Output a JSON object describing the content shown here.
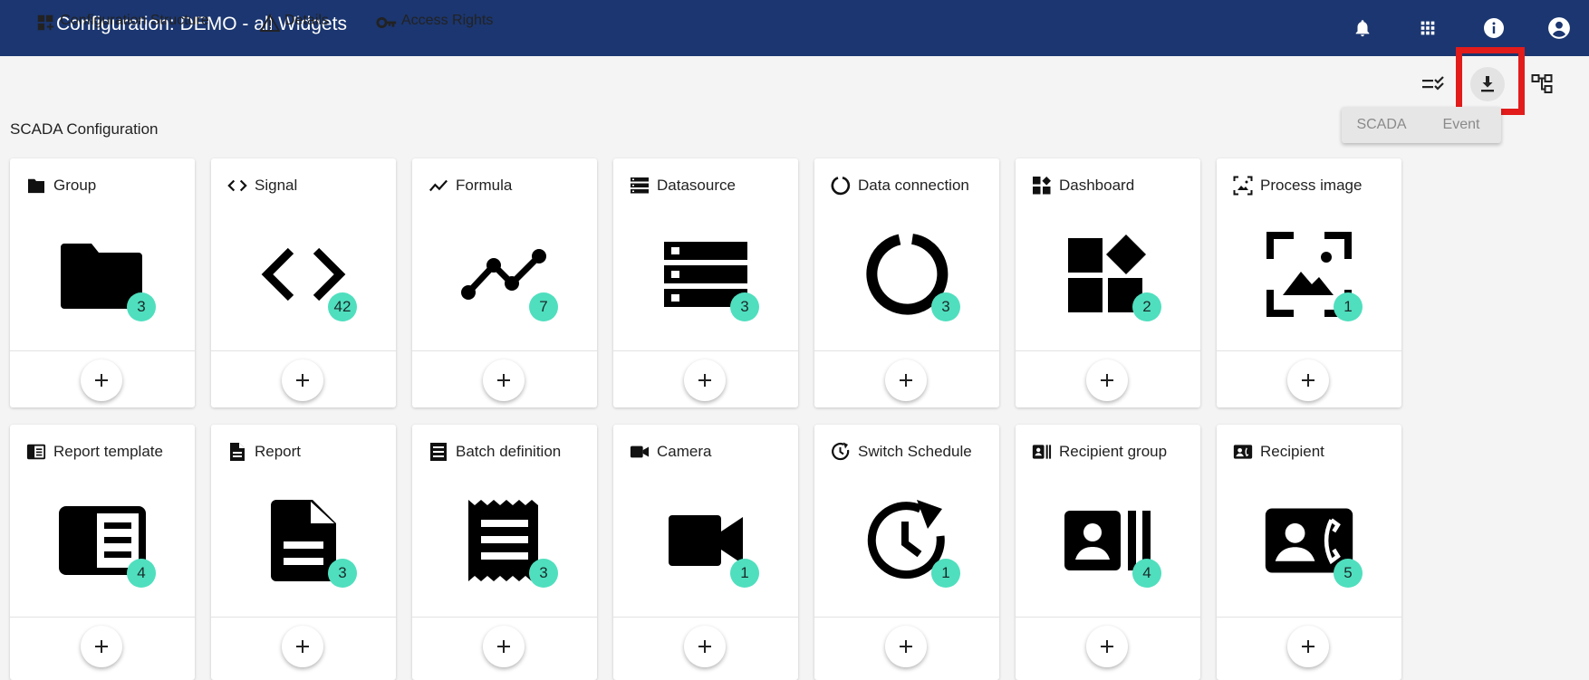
{
  "header": {
    "title": "Configuration: DEMO - all Widgets",
    "icons": [
      "bell-icon",
      "apps-grid-icon",
      "info-icon",
      "account-icon"
    ]
  },
  "tabs": [
    {
      "label": "Configuration Structure",
      "icon": "dashboard-customize-icon",
      "active": true
    },
    {
      "label": "Details",
      "icon": "warning-triangle-icon",
      "active": false
    },
    {
      "label": "Access Rights",
      "icon": "key-icon",
      "active": false
    }
  ],
  "section_title": "SCADA Configuration",
  "toolbar": {
    "icons": [
      "checklist-icon",
      "download-icon",
      "tree-structure-icon"
    ],
    "active": "download-icon"
  },
  "toggle": {
    "options": [
      "SCADA",
      "Event"
    ]
  },
  "cards": [
    {
      "label": "Group",
      "icon": "folder-icon",
      "count": "3"
    },
    {
      "label": "Signal",
      "icon": "code-icon",
      "count": "42"
    },
    {
      "label": "Formula",
      "icon": "trend-line-icon",
      "count": "7"
    },
    {
      "label": "Datasource",
      "icon": "storage-icon",
      "count": "3"
    },
    {
      "label": "Data connection",
      "icon": "donut-ring-icon",
      "count": "3"
    },
    {
      "label": "Dashboard",
      "icon": "widgets-icon",
      "count": "2"
    },
    {
      "label": "Process image",
      "icon": "image-frame-icon",
      "count": "1"
    },
    {
      "label": "Report template",
      "icon": "article-template-icon",
      "count": "4"
    },
    {
      "label": "Report",
      "icon": "document-icon",
      "count": "3"
    },
    {
      "label": "Batch definition",
      "icon": "receipt-icon",
      "count": "3"
    },
    {
      "label": "Camera",
      "icon": "videocam-icon",
      "count": "1"
    },
    {
      "label": "Switch Schedule",
      "icon": "schedule-refresh-icon",
      "count": "1"
    },
    {
      "label": "Recipient group",
      "icon": "contacts-group-icon",
      "count": "4"
    },
    {
      "label": "Recipient",
      "icon": "contact-phone-icon",
      "count": "5"
    }
  ],
  "colors": {
    "header": "#1b3670",
    "badge": "#4fdfbe",
    "highlight": "#e21b1b"
  }
}
